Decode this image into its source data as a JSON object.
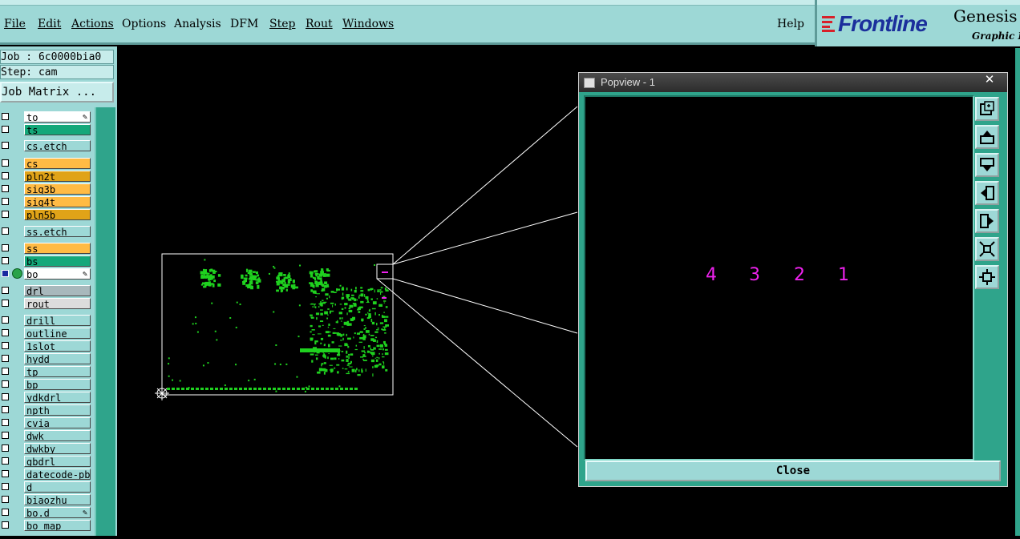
{
  "menubar": {
    "items": [
      {
        "label": "File"
      },
      {
        "label": "Edit"
      },
      {
        "label": "Actions"
      },
      {
        "label": "Options"
      },
      {
        "label": "Analysis"
      },
      {
        "label": "DFM"
      },
      {
        "label": "Step"
      },
      {
        "label": "Rout"
      },
      {
        "label": "Windows"
      }
    ],
    "help": "Help"
  },
  "brand": {
    "name": "Frontline",
    "product": "Genesis",
    "subtitle": "Graphic E"
  },
  "job": {
    "job_line": "Job : 6c0000bia0",
    "step_line": "Step: cam",
    "matrix_button": "Job Matrix ..."
  },
  "layers": [
    {
      "name": "to",
      "color": "#ffffff",
      "mark": "pen"
    },
    {
      "name": "ts",
      "color": "#14a87a"
    },
    {
      "name": "cs.etch",
      "color": "#9dd8d6"
    },
    {
      "name": "cs",
      "color": "#ffbb44"
    },
    {
      "name": "pln2t",
      "color": "#e0a318"
    },
    {
      "name": "sig3b",
      "color": "#ffbb44"
    },
    {
      "name": "sig4t",
      "color": "#ffbb44"
    },
    {
      "name": "pln5b",
      "color": "#e0a318"
    },
    {
      "name": "ss.etch",
      "color": "#9dd8d6"
    },
    {
      "name": "ss",
      "color": "#ffbb44"
    },
    {
      "name": "bs",
      "color": "#14a87a"
    },
    {
      "name": "bo",
      "color": "#ffffff",
      "mark": "pen",
      "selected": true
    },
    {
      "name": "drl",
      "color": "#a8b8bc"
    },
    {
      "name": "rout",
      "color": "#dcdcdc"
    },
    {
      "name": "drill",
      "color": "#9dd8d6"
    },
    {
      "name": "outline",
      "color": "#9dd8d6"
    },
    {
      "name": "1slot",
      "color": "#9dd8d6"
    },
    {
      "name": "hydd",
      "color": "#9dd8d6"
    },
    {
      "name": "tp",
      "color": "#9dd8d6"
    },
    {
      "name": "bp",
      "color": "#9dd8d6"
    },
    {
      "name": "ydkdrl",
      "color": "#9dd8d6"
    },
    {
      "name": "npth",
      "color": "#9dd8d6"
    },
    {
      "name": "cvia",
      "color": "#9dd8d6"
    },
    {
      "name": "dwk",
      "color": "#9dd8d6"
    },
    {
      "name": "dwkby",
      "color": "#9dd8d6"
    },
    {
      "name": "gbdrl",
      "color": "#9dd8d6"
    },
    {
      "name": "datecode-pbe",
      "color": "#9dd8d6"
    },
    {
      "name": "d",
      "color": "#9dd8d6"
    },
    {
      "name": "biaozhu",
      "color": "#9dd8d6"
    },
    {
      "name": "bo.d",
      "color": "#9dd8d6",
      "mark": "pen"
    },
    {
      "name": "bo_map",
      "color": "#9dd8d6"
    }
  ],
  "popview": {
    "title": "Popview - 1",
    "close_x": "✕",
    "numbers": [
      "4",
      "3",
      "2",
      "1"
    ],
    "close_button": "Close",
    "toolbar_icons": [
      "zoom-home-icon",
      "pan-up-icon",
      "pan-down-icon",
      "pan-left-icon",
      "pan-right-icon",
      "zoom-in-icon",
      "zoom-out-icon"
    ]
  }
}
